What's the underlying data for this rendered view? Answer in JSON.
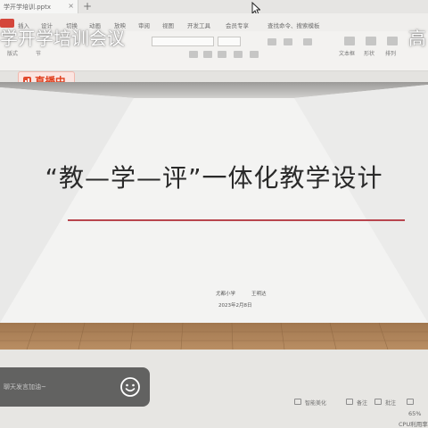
{
  "window": {
    "doc_tab": "学开学培训.pptx",
    "new_tab": "+"
  },
  "menu": {
    "items": [
      "插入",
      "设计",
      "切换",
      "动画",
      "放映",
      "审阅",
      "视图",
      "开发工具",
      "会员专享",
      "查找命令、搜索模板"
    ]
  },
  "toolbar": {
    "font_name": "",
    "labels": [
      "文本框",
      "形状",
      "排列"
    ],
    "misc": [
      "版式",
      "节"
    ]
  },
  "overlay": {
    "meeting_title": "学开学培训会议",
    "meeting_title_right": "高"
  },
  "live": {
    "label": "直播中",
    "color": "#e0401f"
  },
  "slide": {
    "title": "“教—学—评”一体化教学设计",
    "org": "尤都小学",
    "author": "王明达",
    "date": "2023年2月8日",
    "rule_color": "#b8454e"
  },
  "comment": {
    "placeholder": "聊天发言加油~",
    "emoji_icon": "smile-icon"
  },
  "status": {
    "smart_beautify": "智能美化",
    "notes": "备注",
    "annotate": "批注"
  },
  "perf": {
    "zoom": "65%",
    "cpu": "CPU利用率"
  }
}
